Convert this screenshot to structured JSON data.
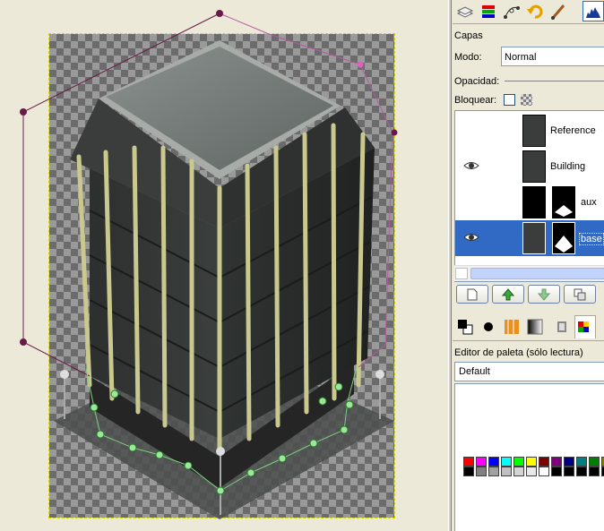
{
  "layers_panel": {
    "title": "Capas",
    "mode_label": "Modo:",
    "mode_value": "Normal",
    "opacity_label": "Opacidad:",
    "lock_label": "Bloquear:",
    "layers": [
      {
        "name": "Reference",
        "visible": false,
        "selected": false,
        "has_mask": false
      },
      {
        "name": "Building",
        "visible": true,
        "selected": false,
        "has_mask": false
      },
      {
        "name": "aux",
        "visible": false,
        "selected": false,
        "has_mask": true
      },
      {
        "name": "base",
        "visible": true,
        "selected": true,
        "has_mask": true
      }
    ],
    "buttons": [
      "new-layer-icon",
      "raise-layer-icon",
      "lower-layer-icon",
      "duplicate-layer-icon"
    ]
  },
  "toolbar_icons": [
    "layers-icon",
    "channels-icon",
    "paths-icon",
    "undo-history-icon",
    "brush-icon",
    "histogram-icon"
  ],
  "palette_panel": {
    "title": "Editor de paleta (sólo lectura)",
    "palette_name": "Default",
    "swatch_colors_row1": [
      "#ff0000",
      "#ff00ff",
      "#0000ff",
      "#00ffff",
      "#00ff00",
      "#ffff00",
      "#800000",
      "#800080",
      "#000080",
      "#008080",
      "#008000",
      "#808000"
    ],
    "swatch_colors_row2": [
      "#000000",
      "#808080",
      "#a0a0a0",
      "#c0c0c0",
      "#d4d4d4",
      "#e8e8e8",
      "#ffffff",
      "#000000",
      "#000000",
      "#000000",
      "#000000",
      "#000000"
    ]
  },
  "colors": {
    "selection_blue": "#316ac5",
    "path_color": "#6a1a4a",
    "bezier_handle": "#9be89b"
  }
}
